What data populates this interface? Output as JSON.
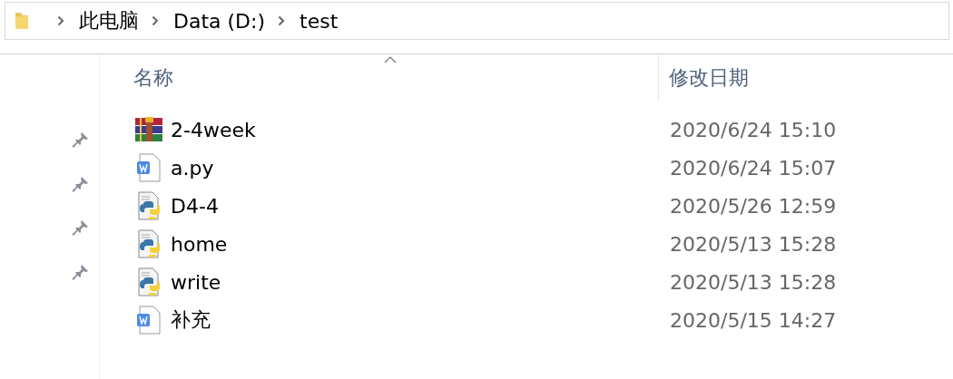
{
  "address_bar": {
    "crumbs": [
      "此电脑",
      "Data (D:)",
      "test"
    ]
  },
  "nav_pane": {
    "pins": [
      {
        "pinned": true
      },
      {
        "pinned": true
      },
      {
        "pinned": true
      },
      {
        "pinned": true
      }
    ]
  },
  "table": {
    "columns": [
      {
        "label": "名称",
        "sorted": true
      },
      {
        "label": "修改日期",
        "sorted": false
      }
    ],
    "rows": [
      {
        "kind": "archive",
        "name": "2-4week",
        "modified": "2020/6/24 15:10"
      },
      {
        "kind": "word",
        "name": "a.py",
        "modified": "2020/6/24 15:07"
      },
      {
        "kind": "python",
        "name": "D4-4",
        "modified": "2020/5/26 12:59"
      },
      {
        "kind": "python",
        "name": "home",
        "modified": "2020/5/13 15:28"
      },
      {
        "kind": "python",
        "name": "write",
        "modified": "2020/5/13 15:28"
      },
      {
        "kind": "word",
        "name": "补充",
        "modified": "2020/5/15 14:27"
      }
    ]
  }
}
